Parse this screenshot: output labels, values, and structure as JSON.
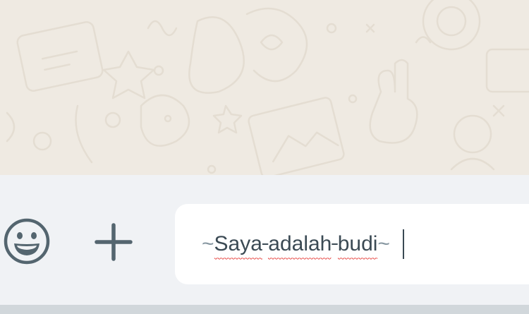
{
  "composer": {
    "emoji_icon": "smiley-emoji-icon",
    "attach_icon": "plus-icon",
    "input": {
      "open_marker": "~",
      "words": [
        "Saya",
        "adalah",
        "budi"
      ],
      "close_marker": "~",
      "formatting": "strikethrough",
      "spellcheck_flagged": true,
      "caret_visible": true
    }
  },
  "colors": {
    "chat_background": "#efeae2",
    "composer_background": "#f0f2f5",
    "input_background": "#ffffff",
    "icon": "#54656f",
    "text": "#3b4a54",
    "spellcheck_underline": "#e53935"
  }
}
